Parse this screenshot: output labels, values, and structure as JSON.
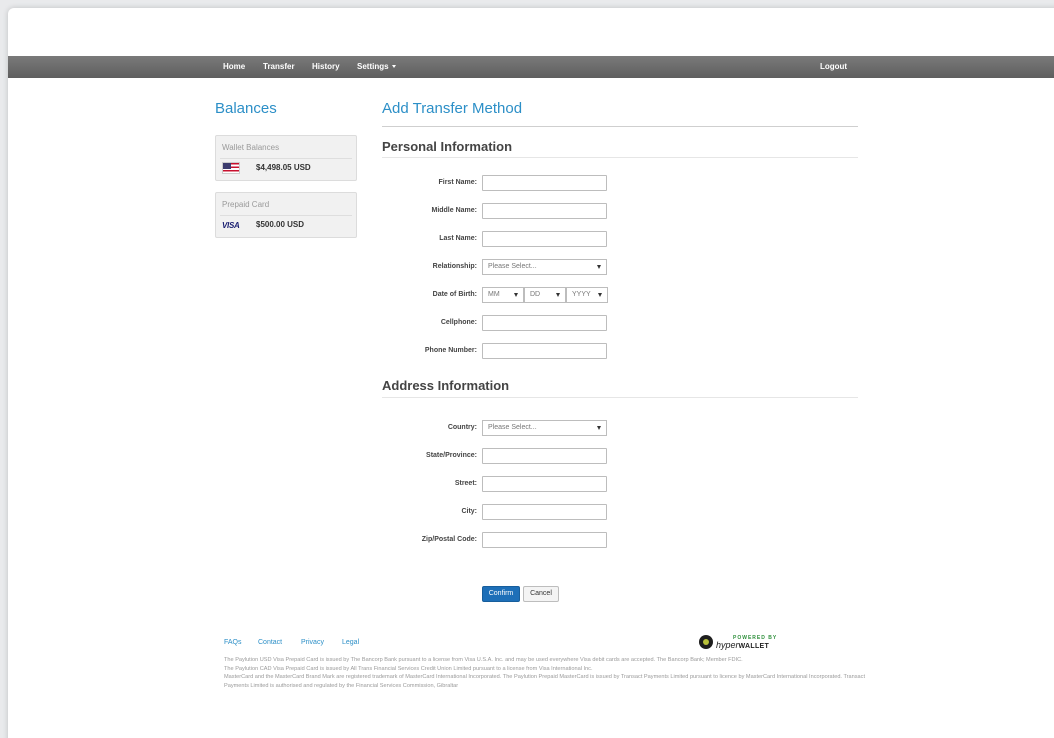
{
  "nav": {
    "items": [
      {
        "label": "Home"
      },
      {
        "label": "Transfer"
      },
      {
        "label": "History"
      },
      {
        "label": "Settings"
      }
    ],
    "logout": "Logout"
  },
  "sidebar": {
    "title": "Balances",
    "wallet": {
      "title": "Wallet Balances",
      "amount": "$4,498.05 USD",
      "icon": "us-flag-icon"
    },
    "prepaid": {
      "title": "Prepaid Card",
      "amount": "$500.00 USD",
      "icon": "visa-icon",
      "brand": "VISA"
    }
  },
  "main": {
    "title": "Add Transfer Method",
    "personal": {
      "title": "Personal Information",
      "fields": {
        "first_name": {
          "label": "First Name:",
          "value": ""
        },
        "middle_name": {
          "label": "Middle Name:",
          "value": ""
        },
        "last_name": {
          "label": "Last Name:",
          "value": ""
        },
        "relationship": {
          "label": "Relationship:",
          "value": "Please Select..."
        },
        "dob": {
          "label": "Date of Birth:",
          "month": "MM",
          "day": "DD",
          "year": "YYYY"
        },
        "cellphone": {
          "label": "Cellphone:",
          "value": ""
        },
        "phone": {
          "label": "Phone Number:",
          "value": ""
        }
      }
    },
    "address": {
      "title": "Address Information",
      "fields": {
        "country": {
          "label": "Country:",
          "value": "Please Select..."
        },
        "state": {
          "label": "State/Province:",
          "value": ""
        },
        "street": {
          "label": "Street:",
          "value": ""
        },
        "city": {
          "label": "City:",
          "value": ""
        },
        "zip": {
          "label": "Zip/Postal Code:",
          "value": ""
        }
      }
    },
    "buttons": {
      "confirm": "Confirm",
      "cancel": "Cancel"
    }
  },
  "footer": {
    "links": [
      "FAQs",
      "Contact",
      "Privacy",
      "Legal"
    ],
    "powered_by": "POWERED BY",
    "brand_hyper": "hyper",
    "brand_wallet": "WALLET",
    "legal": [
      "The Paylution USD Visa Prepaid Card is issued by The Bancorp Bank pursuant to a license from Visa U.S.A. Inc. and may be used everywhere Visa debit cards are accepted. The Bancorp Bank; Member FDIC.",
      "The Paylution CAD Visa Prepaid Card is issued by All Trans Financial Services Credit Union Limited pursuant to a license from Visa International Inc.",
      "MasterCard and the MasterCard Brand Mark are registered trademark of MasterCard International Incorporated. The Paylution Prepaid MasterCard is issued by Transact Payments Limited pursuant to licence by MasterCard International Incorporated. Transact Payments Limited is authorised and regulated by the Financial Services Commission, Gibraltar"
    ]
  },
  "colors": {
    "accent": "#2c8fc7",
    "nav_bg": "#6b6b6b",
    "primary_button": "#1d6fb8"
  }
}
